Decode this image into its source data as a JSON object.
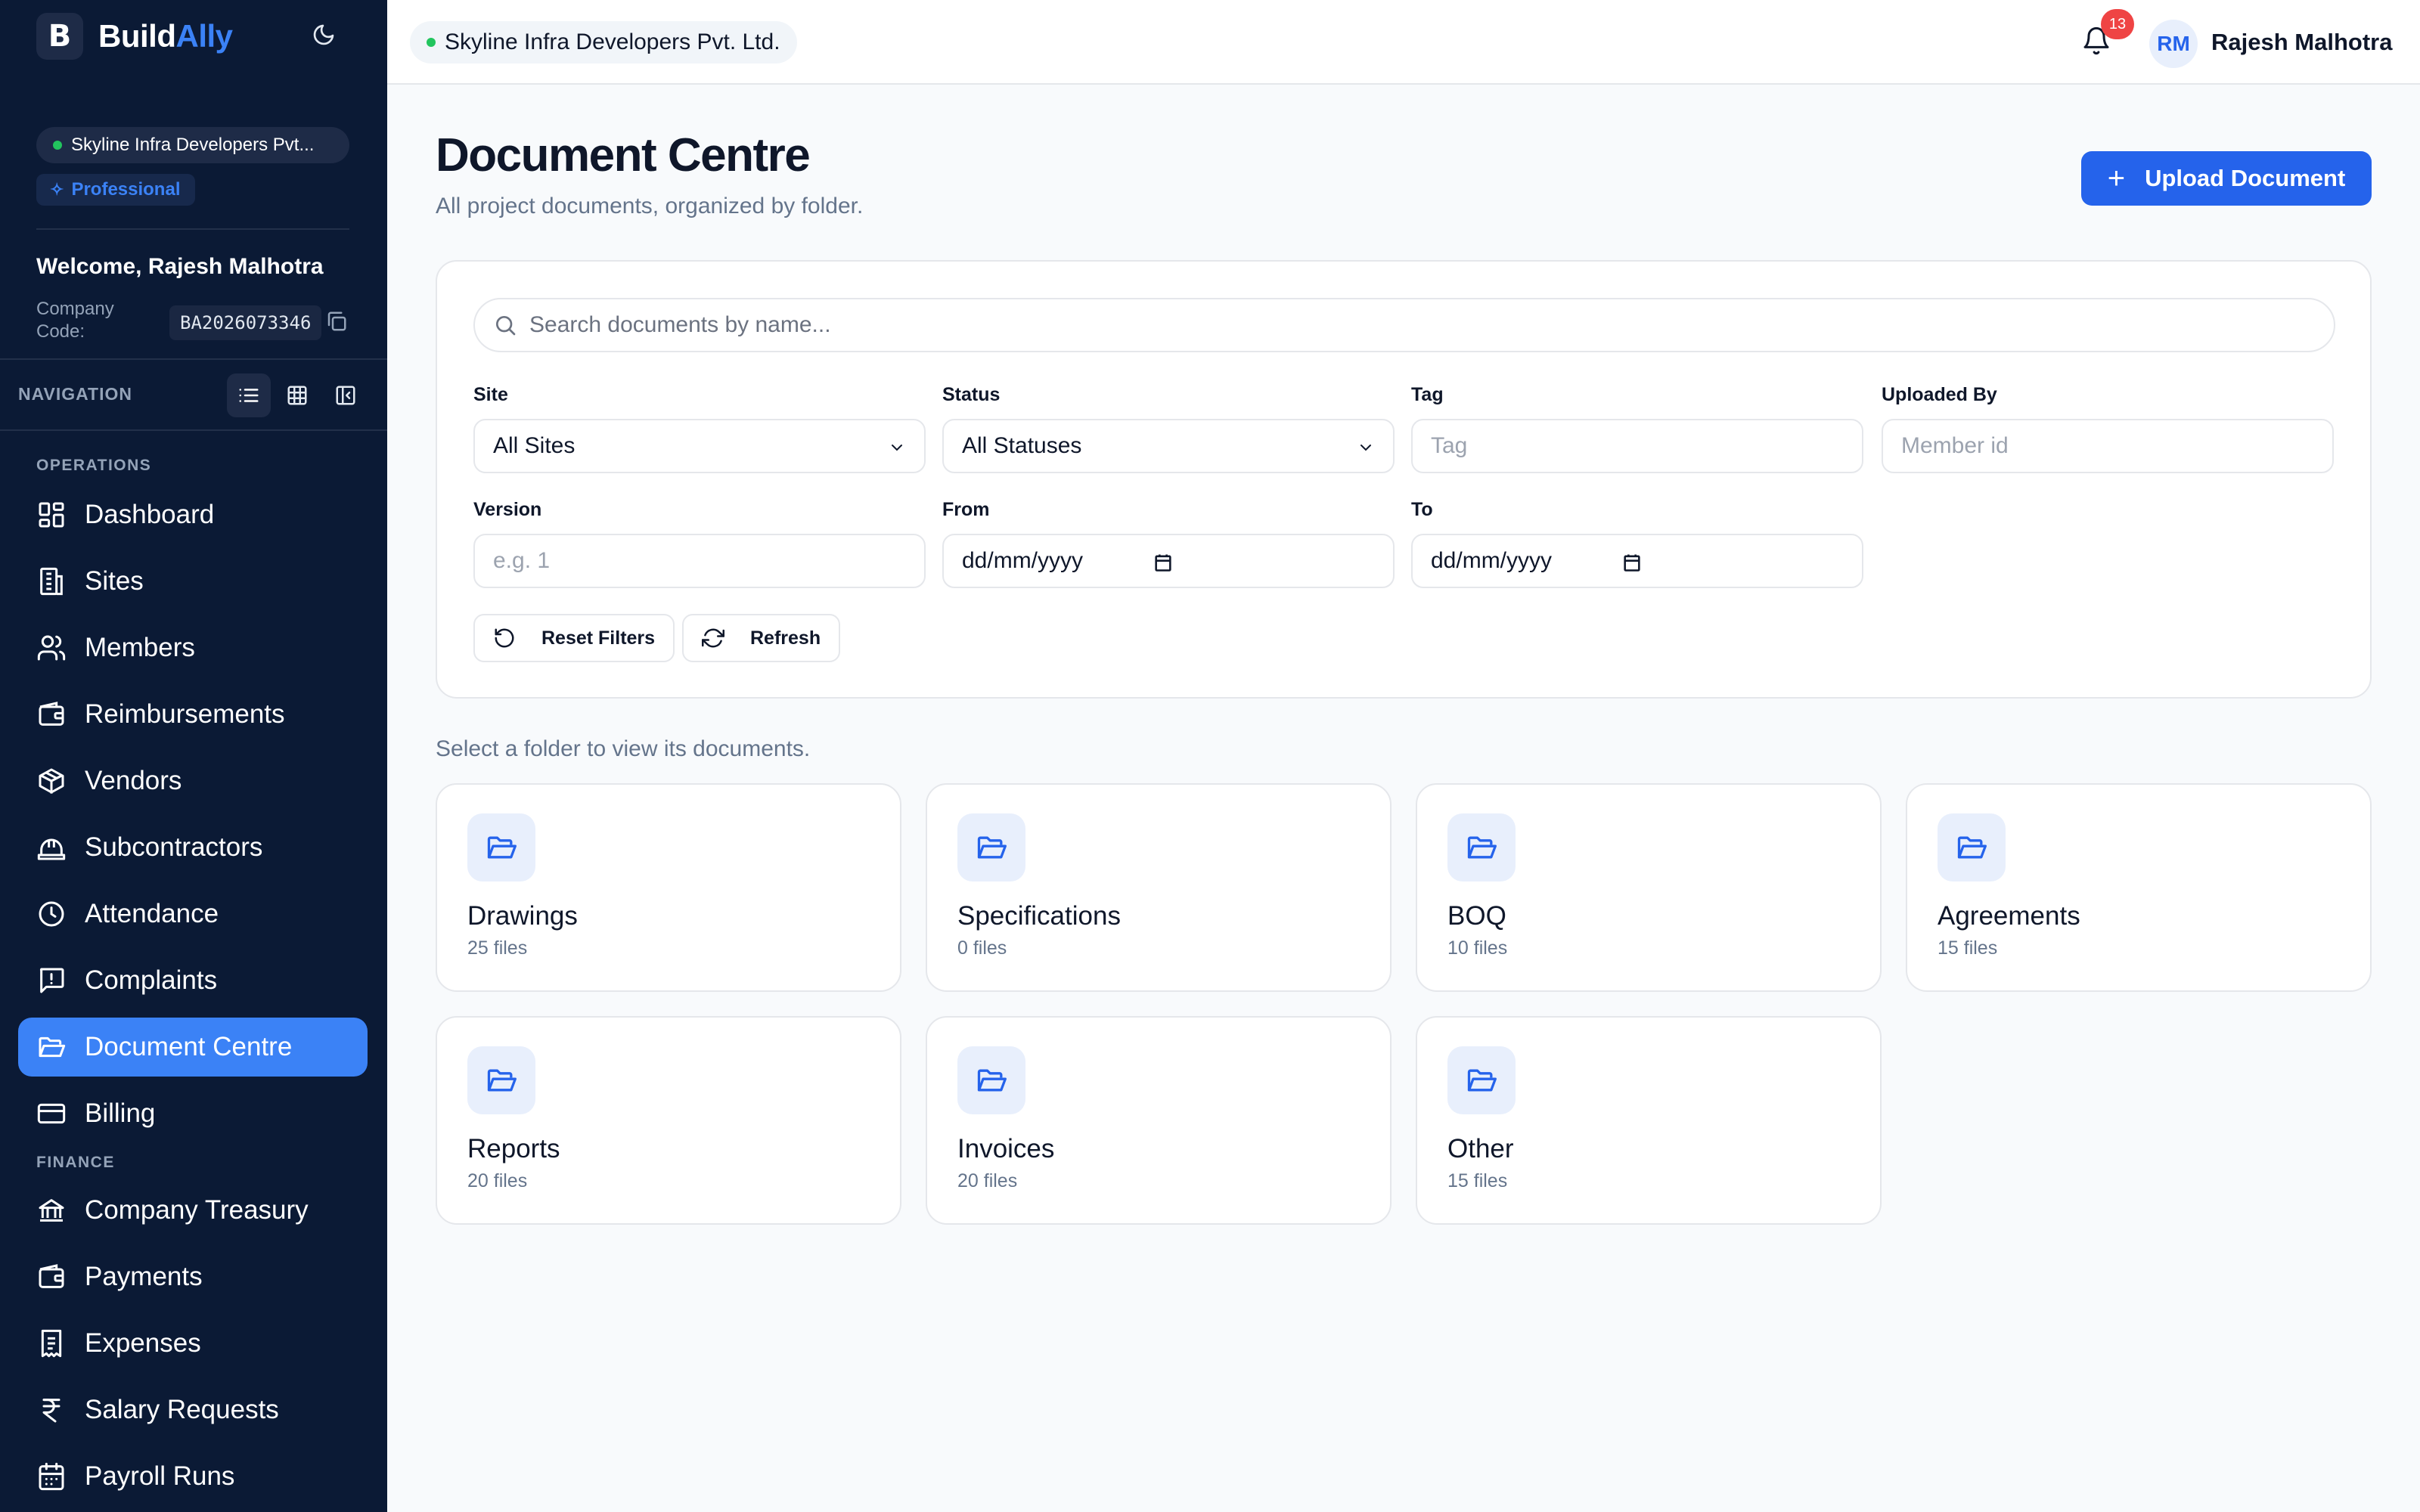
{
  "brand": {
    "name_part1": "Build",
    "name_part2": "Ally",
    "logo_letter": "B"
  },
  "sidebar": {
    "org_name": "Skyline Infra Developers Pvt...",
    "plan": "Professional",
    "welcome": "Welcome, Rajesh Malhotra",
    "company_code_label": "Company Code:",
    "company_code": "BA2026073346",
    "nav_label": "NAVIGATION",
    "sections": {
      "operations": "OPERATIONS",
      "finance": "FINANCE"
    },
    "items": [
      {
        "label": "Dashboard",
        "icon": "dashboard-icon"
      },
      {
        "label": "Sites",
        "icon": "building-icon"
      },
      {
        "label": "Members",
        "icon": "users-icon"
      },
      {
        "label": "Reimbursements",
        "icon": "wallet-icon"
      },
      {
        "label": "Vendors",
        "icon": "package-icon"
      },
      {
        "label": "Subcontractors",
        "icon": "hard-hat-icon"
      },
      {
        "label": "Attendance",
        "icon": "clock-icon"
      },
      {
        "label": "Complaints",
        "icon": "message-alert-icon"
      },
      {
        "label": "Document Centre",
        "icon": "folder-open-icon",
        "active": true
      },
      {
        "label": "Billing",
        "icon": "credit-card-icon"
      },
      {
        "label": "Company Treasury",
        "icon": "bank-icon"
      },
      {
        "label": "Payments",
        "icon": "wallet-icon"
      },
      {
        "label": "Expenses",
        "icon": "receipt-icon"
      },
      {
        "label": "Salary Requests",
        "icon": "rupee-icon"
      },
      {
        "label": "Payroll Runs",
        "icon": "calendar-icon"
      }
    ]
  },
  "topbar": {
    "org_name": "Skyline Infra Developers Pvt. Ltd.",
    "notification_count": "13",
    "avatar_initials": "RM",
    "user_name": "Rajesh Malhotra"
  },
  "page": {
    "title": "Document Centre",
    "subtitle": "All project documents, organized by folder.",
    "upload_label": "Upload Document"
  },
  "filters": {
    "search_placeholder": "Search documents by name...",
    "site_label": "Site",
    "site_value": "All Sites",
    "status_label": "Status",
    "status_value": "All Statuses",
    "tag_label": "Tag",
    "tag_placeholder": "Tag",
    "uploaded_by_label": "Uploaded By",
    "uploaded_by_placeholder": "Member id",
    "version_label": "Version",
    "version_placeholder": "e.g. 1",
    "from_label": "From",
    "from_value": "dd/mm/yyyy",
    "to_label": "To",
    "to_value": "dd/mm/yyyy",
    "reset_label": "Reset Filters",
    "refresh_label": "Refresh"
  },
  "folders_hint": "Select a folder to view its documents.",
  "folders": [
    {
      "name": "Drawings",
      "count": "25 files"
    },
    {
      "name": "Specifications",
      "count": "0 files"
    },
    {
      "name": "BOQ",
      "count": "10 files"
    },
    {
      "name": "Agreements",
      "count": "15 files"
    },
    {
      "name": "Reports",
      "count": "20 files"
    },
    {
      "name": "Invoices",
      "count": "20 files"
    },
    {
      "name": "Other",
      "count": "15 files"
    }
  ],
  "colors": {
    "sidebar_bg": "#0b1a35",
    "accent": "#2563eb",
    "active_nav": "#3b82f6",
    "online": "#22c55e",
    "badge": "#ef4444"
  }
}
